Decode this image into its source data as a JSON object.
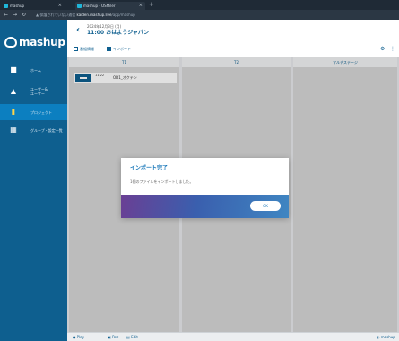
{
  "browser": {
    "tabs": [
      {
        "label": "mashup"
      },
      {
        "label": "mashup - OSMiler"
      }
    ],
    "new_tab_glyph": "+",
    "close_glyph": "×",
    "address": {
      "security": "▲ 保護されていない通信",
      "domain": "kaiden.mashup.live",
      "path": "/app/mashup"
    }
  },
  "sidebar": {
    "brand": "mashup",
    "items": [
      {
        "icon": "home-icon",
        "glyph": "■",
        "label": "ホーム"
      },
      {
        "icon": "user-icon",
        "glyph": "▲",
        "label": "ユーザー&\nユーザー"
      },
      {
        "icon": "bookmark-icon",
        "glyph": "▮",
        "label": "プロジェクト",
        "active": true
      },
      {
        "icon": "grid-icon",
        "glyph": "▦",
        "label": "グループ・設定一覧"
      }
    ]
  },
  "header": {
    "date": "2024年12月3日 (月)",
    "program": "11:00 おはようジャパン",
    "buttons": [
      {
        "icon": "list-icon",
        "label": "番組情報"
      },
      {
        "icon": "import-icon",
        "label": "インポート"
      }
    ],
    "right_icons": [
      "settings-icon",
      "more-icon"
    ]
  },
  "board": {
    "columns": [
      {
        "title": "T1"
      },
      {
        "title": "T2"
      },
      {
        "title": "マルチステージ"
      }
    ],
    "card": {
      "time": "11:22",
      "title": "OD1_オクテン"
    }
  },
  "footer": {
    "items": [
      "Play",
      "Rec",
      "Edit"
    ],
    "right": "mashup"
  },
  "dialog": {
    "title": "インポート完了",
    "message": "1個のファイルをインポートしました。",
    "ok_label": "OK"
  },
  "colors": {
    "accent": "#0e5f8f",
    "sidebar_active": "#0c7fc0",
    "dialog_band_start": "#6a3f94",
    "dialog_band_end": "#3f86c2"
  }
}
